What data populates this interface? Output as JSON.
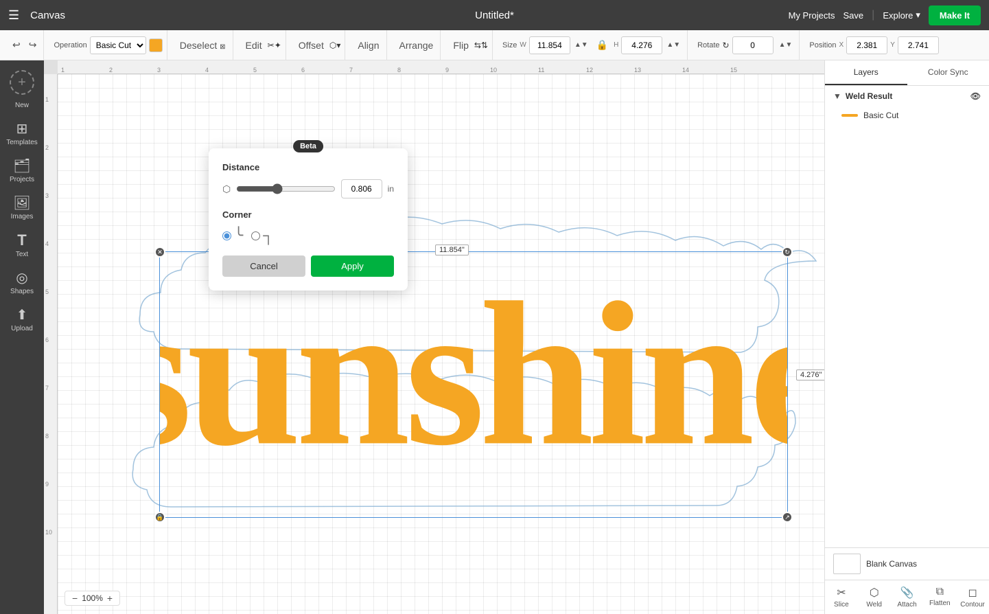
{
  "app": {
    "title": "Canvas",
    "doc_title": "Untitled*",
    "hamburger": "☰"
  },
  "topbar": {
    "my_projects": "My Projects",
    "save": "Save",
    "separator": "|",
    "explore": "Explore",
    "make_it": "Make It"
  },
  "toolbar": {
    "undo_label": "↩",
    "redo_label": "↪",
    "operation_label": "Operation",
    "operation_value": "Basic Cut",
    "deselect_label": "Deselect",
    "edit_label": "Edit",
    "offset_label": "Offset",
    "align_label": "Align",
    "arrange_label": "Arrange",
    "flip_label": "Flip",
    "size_label": "Size",
    "size_w_label": "W",
    "size_w_value": "11.854",
    "size_h_label": "H",
    "size_h_value": "4.276",
    "lock_icon": "🔒",
    "rotate_label": "Rotate",
    "rotate_value": "0",
    "position_label": "Position",
    "pos_x_label": "X",
    "pos_x_value": "2.381",
    "pos_y_label": "Y",
    "pos_y_value": "2.741"
  },
  "sidebar": {
    "items": [
      {
        "label": "New",
        "icon": "+"
      },
      {
        "label": "Templates",
        "icon": "⊞"
      },
      {
        "label": "Projects",
        "icon": "📁"
      },
      {
        "label": "Images",
        "icon": "🖼"
      },
      {
        "label": "Text",
        "icon": "T"
      },
      {
        "label": "Shapes",
        "icon": "◎"
      },
      {
        "label": "Upload",
        "icon": "⬆"
      }
    ]
  },
  "offset_popup": {
    "beta_label": "Beta",
    "distance_label": "Distance",
    "slider_value": "0.806",
    "slider_unit": "in",
    "corner_label": "Corner",
    "corner_round_selected": true,
    "cancel_label": "Cancel",
    "apply_label": "Apply"
  },
  "canvas": {
    "text": "sunshine",
    "width_label": "11.854\"",
    "height_label": "4.276\"",
    "zoom_level": "100%"
  },
  "right_panel": {
    "tabs": [
      {
        "label": "Layers",
        "active": true
      },
      {
        "label": "Color Sync",
        "active": false
      }
    ],
    "weld_result": "Weld Result",
    "layer_name": "Basic Cut",
    "blank_canvas_label": "Blank Canvas"
  },
  "panel_actions": [
    {
      "label": "Slice",
      "icon": "✂"
    },
    {
      "label": "Weld",
      "icon": "⬡"
    },
    {
      "label": "Attach",
      "icon": "📎"
    },
    {
      "label": "Flatten",
      "icon": "⧉"
    },
    {
      "label": "Contour",
      "icon": "◻"
    }
  ]
}
